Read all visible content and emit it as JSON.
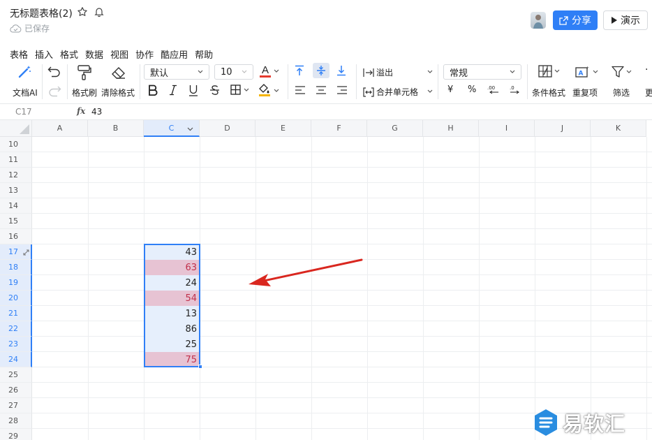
{
  "app": {
    "title": "无标题表格(2)",
    "save_status": "已保存",
    "share_label": "分享",
    "present_label": "演示"
  },
  "menu": [
    "表格",
    "插入",
    "格式",
    "数据",
    "视图",
    "协作",
    "酷应用",
    "帮助"
  ],
  "toolbar": {
    "ai_label": "文档AI",
    "format_painter_label": "格式刷",
    "clear_format_label": "清除格式",
    "font_family": "默认",
    "font_size": "10",
    "overflow_label": "溢出",
    "merge_label": "合并单元格",
    "number_format": "常规",
    "conditional_format_label": "条件格式",
    "duplicates_label": "重复项",
    "filter_label": "筛选",
    "more_label": "更",
    "currency_symbol": "¥",
    "percent_symbol": "%",
    "font_color_letter": "A"
  },
  "formula_bar": {
    "cell_ref": "C17",
    "fx_label": "fx",
    "value": "43"
  },
  "columns": [
    "A",
    "B",
    "C",
    "D",
    "E",
    "F",
    "G",
    "H",
    "I",
    "J",
    "K"
  ],
  "rows": [
    "10",
    "11",
    "12",
    "13",
    "14",
    "15",
    "16",
    "17",
    "18",
    "19",
    "20",
    "21",
    "22",
    "23",
    "24",
    "25",
    "26",
    "27",
    "28",
    "29"
  ],
  "selected_column": "C",
  "cells": [
    {
      "row": "17",
      "value": "43",
      "highlight": false
    },
    {
      "row": "18",
      "value": "63",
      "highlight": true
    },
    {
      "row": "19",
      "value": "24",
      "highlight": false
    },
    {
      "row": "20",
      "value": "54",
      "highlight": true
    },
    {
      "row": "21",
      "value": "13",
      "highlight": false
    },
    {
      "row": "22",
      "value": "86",
      "highlight": false
    },
    {
      "row": "23",
      "value": "25",
      "highlight": false
    },
    {
      "row": "24",
      "value": "75",
      "highlight": true
    }
  ],
  "colors": {
    "accent": "#2f7ff6",
    "highlight_bg": "#e7c3d3",
    "highlight_text": "#c0304b",
    "selection_bg": "#e6effc",
    "arrow": "#d9271f"
  },
  "watermark": "易软汇"
}
